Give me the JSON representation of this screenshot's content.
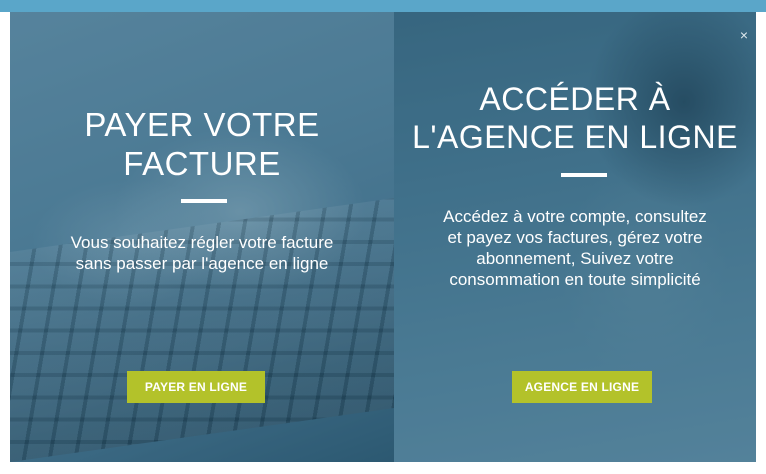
{
  "modal": {
    "close_icon": "×",
    "left": {
      "title_line1": "PAYER VOTRE",
      "title_line2": "FACTURE",
      "description_line1": "Vous souhaitez régler votre facture",
      "description_line2": "sans passer par l'agence en ligne",
      "button_label": "PAYER EN LIGNE"
    },
    "right": {
      "title_line1": "ACCÉDER À",
      "title_line2": "L'AGENCE EN LIGNE",
      "description_line1": "Accédez à votre compte, consultez",
      "description_line2": "et payez vos factures, gérez votre",
      "description_line3": "abonnement, Suivez votre",
      "description_line4": "consommation en toute simplicité",
      "button_label": "AGENCE EN LIGNE"
    }
  },
  "colors": {
    "accent_bar": "#5aa6c9",
    "button": "#b3c22a",
    "text": "#ffffff"
  }
}
